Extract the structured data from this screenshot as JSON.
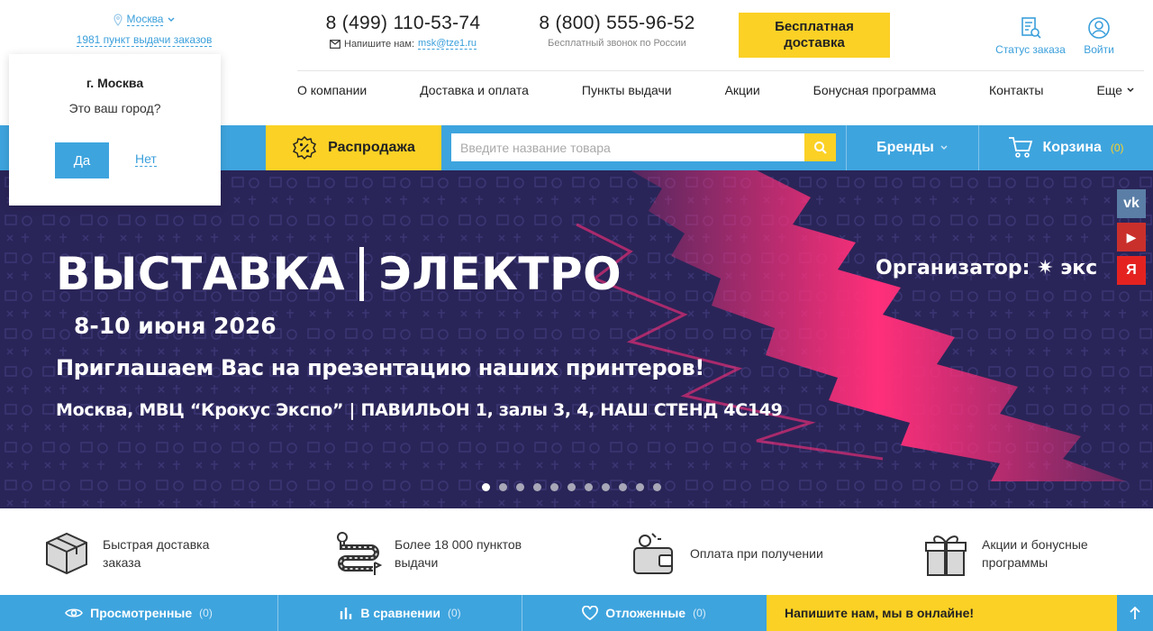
{
  "header": {
    "city": "Москва",
    "pickup_link": "1981 пункт выдачи заказов",
    "phone1": "8 (499) 110-53-74",
    "write_label": "Напишите нам:",
    "email": "msk@tze1.ru",
    "phone2": "8 (800) 555-96-52",
    "phone2_sub": "Бесплатный звонок по России",
    "free_delivery": "Бесплатная доставка",
    "order_status": "Статус заказа",
    "login": "Войти"
  },
  "nav": {
    "items": [
      "О компании",
      "Доставка и оплата",
      "Пункты выдачи",
      "Акции",
      "Бонусная программа",
      "Контакты",
      "Еще"
    ]
  },
  "toolbar": {
    "sale": "Распродажа",
    "search_placeholder": "Введите название товара",
    "brands": "Бренды",
    "cart": "Корзина",
    "cart_count": "(0)"
  },
  "banner": {
    "title_left": "ВЫСТАВКА",
    "title_right": "ЭЛЕКТРО",
    "organizer": "Организатор:  ✷ экс",
    "date": "8-10 июня 2026",
    "invite": "Приглашаем Вас на презентацию наших принтеров!",
    "location": "Москва, МВЦ “Крокус Экспо” | ПАВИЛЬОН 1, залы 3, 4, НАШ СТЕНД 4С149",
    "slide_count": 11,
    "active_slide": 1
  },
  "socials": {
    "vk": "vk",
    "youtube": "▶",
    "yandex": "Я"
  },
  "city_popup": {
    "city": "г. Москва",
    "question": "Это ваш город?",
    "yes": "Да",
    "no": "Нет"
  },
  "features": [
    {
      "text": "Быстрая доставка заказа",
      "icon": "box-icon"
    },
    {
      "text": "Более 18 000 пунктов выдачи",
      "icon": "route-icon"
    },
    {
      "text": "Оплата при получении",
      "icon": "wallet-icon"
    },
    {
      "text": "Акции и бонусные программы",
      "icon": "gift-icon"
    }
  ],
  "bottom_bar": {
    "viewed": "Просмотренные",
    "viewed_count": "(0)",
    "compare": "В сравнении",
    "compare_count": "(0)",
    "deferred": "Отложенные",
    "deferred_count": "(0)",
    "chat": "Напишите нам, мы в онлайне!"
  },
  "colors": {
    "accent_blue": "#3ea4de",
    "accent_yellow": "#fbd125",
    "banner_bg": "#2a2558",
    "banner_pink": "#ff2f7a"
  }
}
